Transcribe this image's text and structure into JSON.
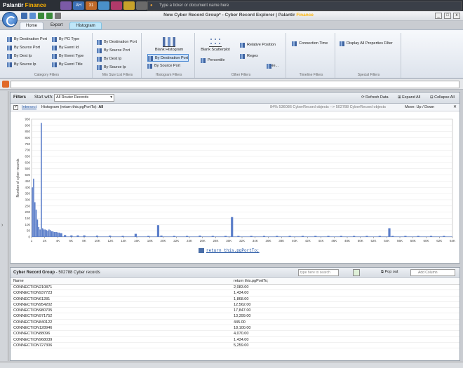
{
  "top_bar": {
    "logo_brand": "Palantir",
    "logo_product": "Finance",
    "app_icons": [
      {
        "label": "",
        "color": "#7b5aa6"
      },
      {
        "label": "AH",
        "color": "#3a6fb5"
      },
      {
        "label": "31",
        "color": "#c06a2a"
      },
      {
        "label": "",
        "color": "#4a90c8"
      },
      {
        "label": "",
        "color": "#b03a6a"
      },
      {
        "label": "",
        "color": "#c8a22a"
      },
      {
        "label": "",
        "color": "#6a6a6a"
      }
    ],
    "search_placeholder": "Type a ticker or document name here"
  },
  "window": {
    "title": "New Cyber Record Group* - Cyber Record Explorer | ",
    "brand": "Palantir",
    "brand_product": "Finance"
  },
  "ribbon": {
    "tabs": [
      "Home",
      "Export",
      "Histogram"
    ],
    "active_tab": "Home",
    "groups": {
      "category": {
        "label": "Category Filters",
        "col1": [
          "By Destination Port",
          "By Source Port",
          "By Dest Ip",
          "By Source Ip"
        ],
        "col2": [
          "By PG Type",
          "By Event Id",
          "By Event Type",
          "By Event Title"
        ]
      },
      "minsizelist": {
        "label": "Min Size List Filters",
        "items": [
          "By Destination Port",
          "By Source Port",
          "By Dest Ip",
          "By Source Ip"
        ]
      },
      "histogram": {
        "label": "Histogram Filters",
        "blank": "Blank Histogram",
        "items": [
          "By Destination Port",
          "By Source Port"
        ]
      },
      "other": {
        "label": "Other Filters",
        "scatter": "Blank Scatterplot",
        "percentile": "Percentile",
        "relpos": "Relative Position",
        "regex": "Regex",
        "more": "More..."
      },
      "timeline": {
        "label": "Timeline Filters",
        "conn_time": "Connection Time"
      },
      "special": {
        "label": "Special Filters",
        "display_all": "Display All Properties Filter"
      }
    }
  },
  "filters": {
    "title": "Filters",
    "start_with_label": "Start with:",
    "start_with_value": "All Router Records",
    "refresh": "Refresh Data",
    "expand": "Expand All",
    "collapse": "Collapse All",
    "intersect": "Intersect",
    "histogram_desc": "Histogram (return this.pgPortTo):",
    "all": "All",
    "stats": "84%   536086 CyberRecord objects  -->  502788 CyberRecord objects",
    "move": "Move:  Up  /  Down",
    "return_link": "return this.pgPortTo;"
  },
  "chart_data": {
    "type": "bar",
    "ylabel": "Number of cyber records",
    "xlabel": "return this.pgPortTo;",
    "ylim": [
      0,
      950
    ],
    "xlim": [
      0,
      65536
    ],
    "y_ticks": [
      "950",
      "900",
      "850",
      "800",
      "750",
      "700",
      "650",
      "600",
      "550",
      "500",
      "450",
      "400",
      "350",
      "300",
      "250",
      "200",
      "150",
      "100",
      "50",
      "0"
    ],
    "x_ticks": [
      "1",
      "2K",
      "4K",
      "6K",
      "8K",
      "10K",
      "12K",
      "14K",
      "16K",
      "18K",
      "20K",
      "22K",
      "24K",
      "26K",
      "28K",
      "30K",
      "32K",
      "34K",
      "36K",
      "38K",
      "40K",
      "42K",
      "44K",
      "46K",
      "48K",
      "50K",
      "52K",
      "54K",
      "56K",
      "58K",
      "60K",
      "62K",
      "64K"
    ],
    "bar_color": "#5b7ec9",
    "series": [
      {
        "x": [
          0,
          200,
          400,
          600,
          800,
          1000,
          1200,
          1400,
          1600,
          1800,
          2000,
          2200,
          2400,
          2600,
          2800,
          3000,
          3200,
          3400,
          3600,
          3800,
          4000,
          4200,
          4400,
          5000,
          6000,
          7000,
          8000,
          10000,
          12000,
          14000,
          16000,
          18000,
          19500,
          20000,
          22000,
          24000,
          26000,
          28000,
          30000,
          31000,
          32000,
          34000,
          36000,
          38000,
          40000,
          42000,
          44000,
          46000,
          48000,
          50000,
          52000,
          54000,
          55500,
          56000,
          58000,
          60000,
          62000,
          64000
        ],
        "values": [
          400,
          470,
          280,
          220,
          140,
          80,
          60,
          920,
          70,
          60,
          60,
          55,
          50,
          60,
          55,
          45,
          45,
          40,
          40,
          40,
          35,
          35,
          30,
          15,
          12,
          12,
          12,
          10,
          10,
          8,
          25,
          8,
          95,
          10,
          8,
          8,
          10,
          8,
          8,
          160,
          8,
          8,
          8,
          8,
          8,
          8,
          8,
          8,
          8,
          8,
          8,
          8,
          70,
          8,
          8,
          8,
          8,
          8
        ]
      }
    ]
  },
  "grid": {
    "title": "Cyber Record Group",
    "subtitle": " - 502788 Cyber records",
    "search_placeholder": "type here to search",
    "pop_out": "Pop out",
    "add_column": "Add Column",
    "columns": [
      "Name",
      "return this.pgPortTo;"
    ],
    "rows": [
      [
        "CONNECTION210871",
        "2,083.00"
      ],
      [
        "CONNECTION937723",
        "1,434.00"
      ],
      [
        "CONNECTION61281",
        "1,868.00"
      ],
      [
        "CONNECTION954202",
        "12,562.00"
      ],
      [
        "CONNECTION980705",
        "17,847.00"
      ],
      [
        "CONNECTION971752",
        "13,399.00"
      ],
      [
        "CONNECTION840122",
        "445.00"
      ],
      [
        "CONNECTION128946",
        "18,100.00"
      ],
      [
        "CONNECTION88096",
        "4,070.00"
      ],
      [
        "CONNECTION968039",
        "1,434.00"
      ],
      [
        "CONNECTION727306",
        "5,259.00"
      ]
    ]
  }
}
